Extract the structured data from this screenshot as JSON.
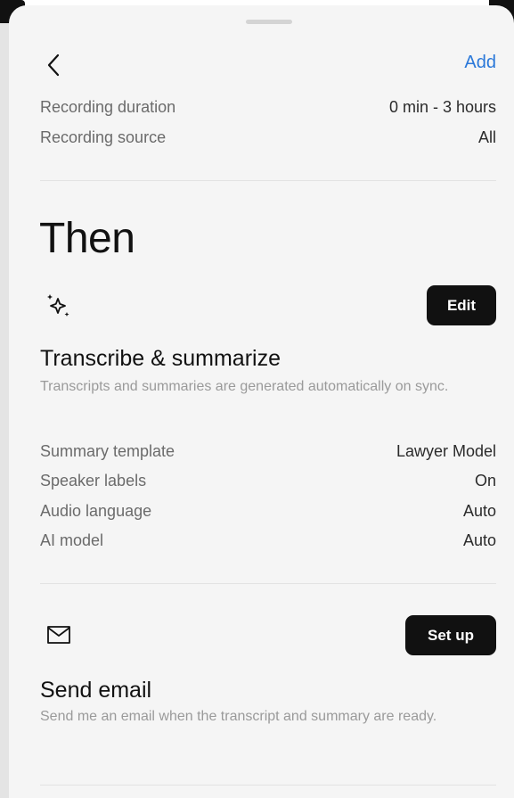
{
  "header": {
    "back_icon": "chevron-left-icon",
    "add_label": "Add"
  },
  "conditions": [
    {
      "label": "Recording duration",
      "value": "0 min - 3 hours"
    },
    {
      "label": "Recording source",
      "value": "All"
    }
  ],
  "then_heading": "Then",
  "transcribe": {
    "icon": "sparkles-icon",
    "button_label": "Edit",
    "title": "Transcribe & summarize",
    "description": "Transcripts and summaries are generated automatically on sync.",
    "settings": [
      {
        "label": "Summary template",
        "value": "Lawyer Model"
      },
      {
        "label": "Speaker labels",
        "value": "On"
      },
      {
        "label": "Audio language",
        "value": "Auto"
      },
      {
        "label": "AI model",
        "value": "Auto"
      }
    ]
  },
  "email": {
    "icon": "mail-icon",
    "button_label": "Set up",
    "title": "Send email",
    "description": "Send me an email when the transcript and summary are ready."
  },
  "colors": {
    "accent": "#2a78d9",
    "sheet_background": "#f5f5f5",
    "button_background": "#111111"
  }
}
